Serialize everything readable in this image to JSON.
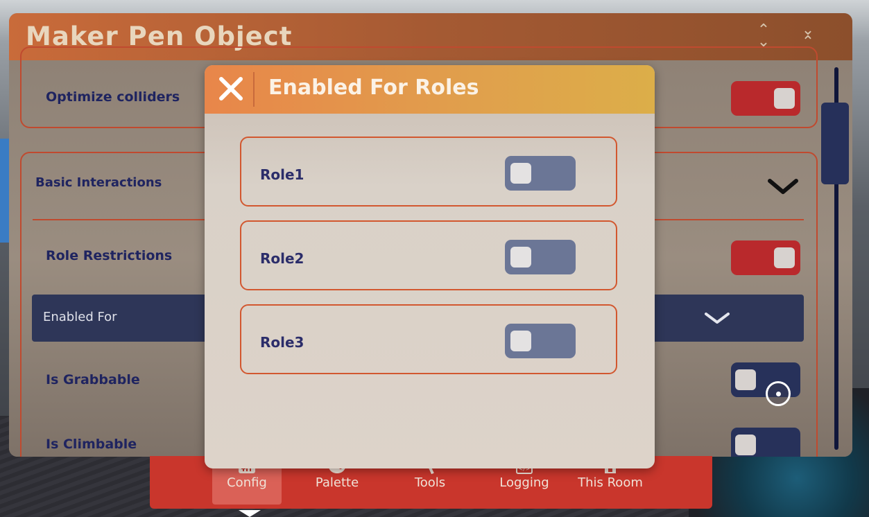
{
  "window": {
    "title": "Maker Pen Object"
  },
  "panel": {
    "optimize_colliders": {
      "label": "Optimize colliders",
      "state": "on"
    },
    "basic_interactions": {
      "label": "Basic Interactions"
    },
    "role_restrictions": {
      "label": "Role Restrictions",
      "state": "on"
    },
    "enabled_for": {
      "label": "Enabled For"
    },
    "is_grabbable": {
      "label": "Is Grabbable",
      "state": "off"
    },
    "is_climbable": {
      "label": "Is Climbable",
      "state": "off"
    }
  },
  "modal": {
    "title": "Enabled For Roles",
    "roles": [
      {
        "label": "Role1",
        "state": "off"
      },
      {
        "label": "Role2",
        "state": "off"
      },
      {
        "label": "Role3",
        "state": "off"
      }
    ]
  },
  "toolbar": {
    "items": [
      {
        "label": "Config",
        "icon": "sliders-icon",
        "active": true
      },
      {
        "label": "Palette",
        "icon": "palette-icon"
      },
      {
        "label": "Tools",
        "icon": "hammer-icon"
      },
      {
        "label": "Logging",
        "icon": "code-window-icon"
      },
      {
        "label": "This Room",
        "icon": "home-icon"
      }
    ]
  },
  "colors": {
    "titlebar": "#a55a33",
    "accent_red": "#b9292c",
    "toggle_off": "#27315a",
    "modal_header": "#e0a04c",
    "toolbar": "#c9362c"
  }
}
